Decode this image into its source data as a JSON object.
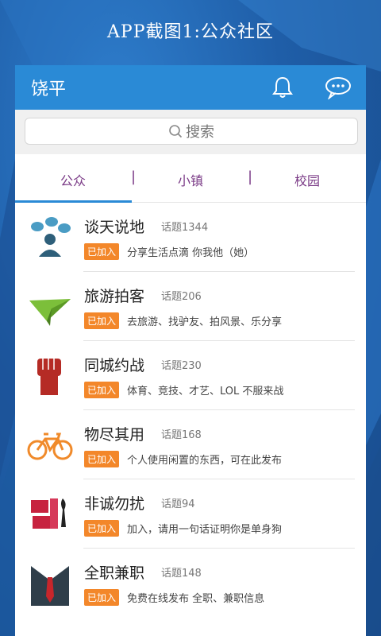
{
  "caption": "APP截图1:公众社区",
  "appbar": {
    "title": "饶平"
  },
  "search": {
    "placeholder": "搜索"
  },
  "tabs": [
    {
      "label": "公众"
    },
    {
      "label": "小镇"
    },
    {
      "label": "校园"
    }
  ],
  "tab_separator": "|",
  "communities": [
    {
      "name": "谈天说地",
      "topics": "话题1344",
      "badge": "已加入",
      "desc": "分享生活点滴 你我他（她）",
      "icon": "chat-bubbles-person-icon"
    },
    {
      "name": "旅游拍客",
      "topics": "话题206",
      "badge": "已加入",
      "desc": "去旅游、找驴友、拍风景、乐分享",
      "icon": "paper-plane-icon"
    },
    {
      "name": "同城约战",
      "topics": "话题230",
      "badge": "已加入",
      "desc": "体育、竞技、才艺、LOL 不服来战",
      "icon": "raised-fist-icon"
    },
    {
      "name": "物尽其用",
      "topics": "话题168",
      "badge": "已加入",
      "desc": "个人使用闲置的东西，可在此发布",
      "icon": "bicycle-icon"
    },
    {
      "name": "非诚勿扰",
      "topics": "话题94",
      "badge": "已加入",
      "desc": "加入，请用一句话证明你是单身狗",
      "icon": "feichengwurao-logo-icon"
    },
    {
      "name": "全职兼职",
      "topics": "话题148",
      "badge": "已加入",
      "desc": "免费在线发布 全职、兼职信息",
      "icon": "suit-tie-icon"
    }
  ],
  "colors": {
    "appbar": "#2a8ad6",
    "badge": "#f3872a",
    "tab_text": "#7a3a86"
  }
}
